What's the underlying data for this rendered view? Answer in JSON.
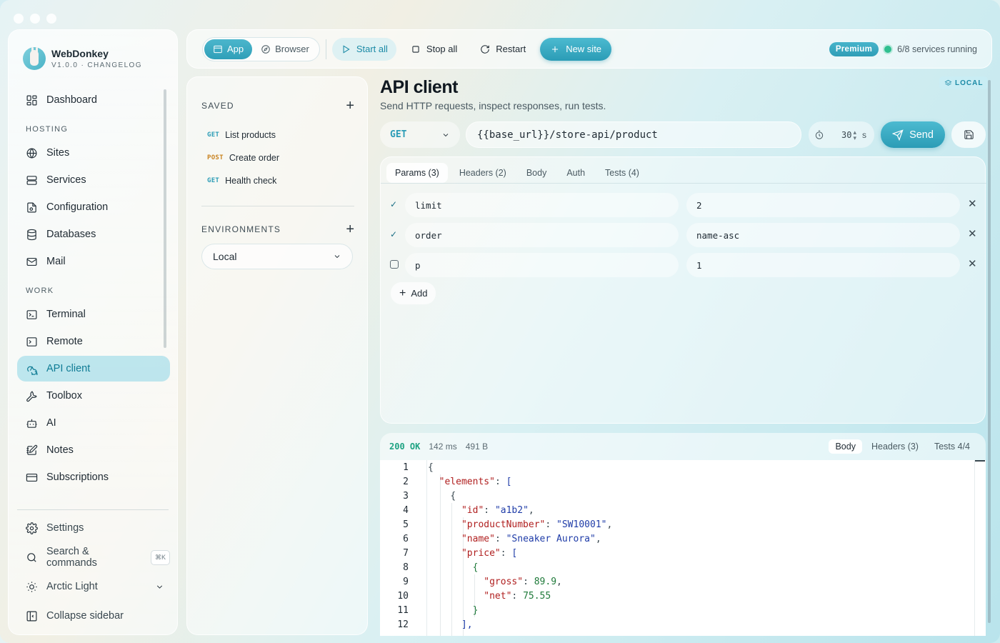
{
  "app": {
    "name": "WebDonkey",
    "version_line": "V1.0.0 · CHANGELOG"
  },
  "sidebar": {
    "top": [
      {
        "label": "Dashboard",
        "icon": "dashboard-icon"
      }
    ],
    "sections": [
      {
        "title": "HOSTING",
        "items": [
          {
            "label": "Sites",
            "icon": "globe-icon"
          },
          {
            "label": "Services",
            "icon": "server-icon"
          },
          {
            "label": "Configuration",
            "icon": "config-file-icon"
          },
          {
            "label": "Databases",
            "icon": "database-icon"
          },
          {
            "label": "Mail",
            "icon": "mail-icon"
          }
        ]
      },
      {
        "title": "WORK",
        "items": [
          {
            "label": "Terminal",
            "icon": "terminal-icon"
          },
          {
            "label": "Remote",
            "icon": "remote-terminal-icon"
          },
          {
            "label": "API client",
            "icon": "webhook-icon",
            "active": true
          },
          {
            "label": "Toolbox",
            "icon": "wrench-icon"
          },
          {
            "label": "AI",
            "icon": "bot-icon"
          },
          {
            "label": "Notes",
            "icon": "notebook-pen-icon"
          },
          {
            "label": "Subscriptions",
            "icon": "credit-card-icon"
          }
        ]
      }
    ],
    "bottom": {
      "settings": "Settings",
      "search": "Search & commands",
      "search_shortcut": "⌘K",
      "theme": "Arctic Light",
      "collapse": "Collapse sidebar"
    }
  },
  "toolbar": {
    "mode_app": "App",
    "mode_browser": "Browser",
    "start_all": "Start all",
    "stop_all": "Stop all",
    "restart": "Restart",
    "new_site": "New site",
    "premium": "Premium",
    "services_status": "6/8 services running",
    "status_color": "#2fbf8f"
  },
  "saved_panel": {
    "title": "SAVED",
    "requests": [
      {
        "method": "GET",
        "name": "List products"
      },
      {
        "method": "POST",
        "name": "Create order"
      },
      {
        "method": "GET",
        "name": "Health check"
      }
    ],
    "env_title": "ENVIRONMENTS",
    "env_selected": "Local"
  },
  "main": {
    "title": "API client",
    "subtitle": "Send HTTP requests, inspect responses, run tests.",
    "env_badge": "LOCAL",
    "method": "GET",
    "url": "{{base_url}}/store-api/product",
    "timeout_value": "30",
    "timeout_unit": "s",
    "send": "Send",
    "tabs": [
      "Params (3)",
      "Headers (2)",
      "Body",
      "Auth",
      "Tests (4)"
    ],
    "active_tab": "Params (3)",
    "params": [
      {
        "enabled": true,
        "key": "limit",
        "value": "2"
      },
      {
        "enabled": true,
        "key": "order",
        "value": "name-asc"
      },
      {
        "enabled": false,
        "key": "p",
        "value": "1"
      }
    ],
    "add_label": "Add"
  },
  "response": {
    "status": "200 OK",
    "time": "142 ms",
    "size": "491 B",
    "tabs": [
      "Body",
      "Headers (3)",
      "Tests 4/4"
    ],
    "active_tab": "Body",
    "line_numbers": [
      "1",
      "2",
      "3",
      "4",
      "5",
      "6",
      "7",
      "8",
      "9",
      "10",
      "11",
      "12"
    ]
  },
  "colors": {
    "accent": "#2b9cb6",
    "post_method": "#c98320",
    "status_ok": "#1fa383"
  }
}
